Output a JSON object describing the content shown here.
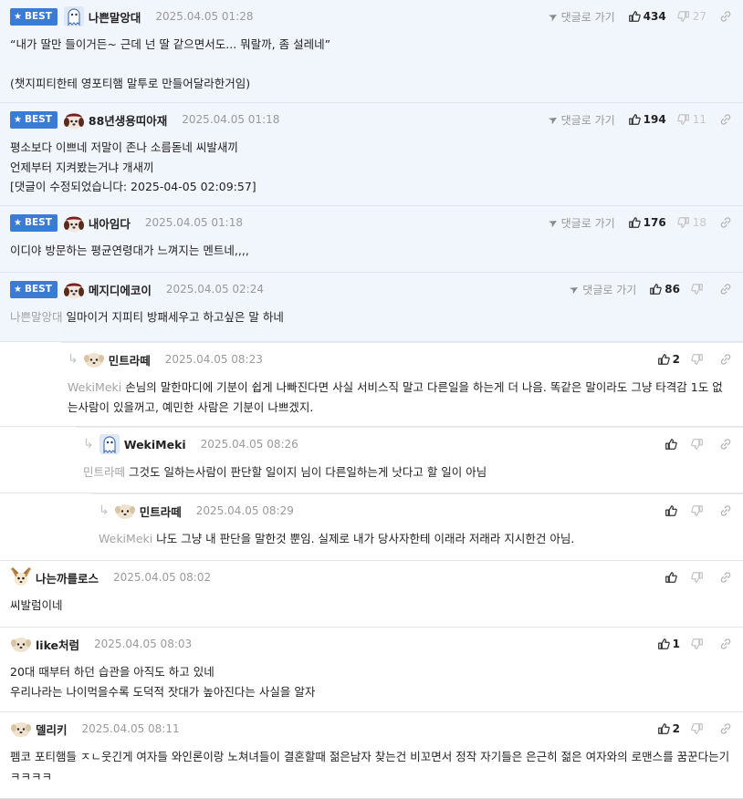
{
  "ui": {
    "best_label": "BEST",
    "goto_label": "댓글로 가기"
  },
  "comments": [
    {
      "best": true,
      "depth": 0,
      "height": 113,
      "avatar": "ghost-avatar",
      "nickname": "나쁜말앙대",
      "date": "2025.04.05 01:28",
      "goto": true,
      "up": "434",
      "down": "27",
      "parent": "",
      "text": "“내가 딸만 들이거든~ 근데 넌 딸 같으면서도... 뭐랄까, 좀 설레네”\n\n(챗지피티한테 영포티햄 말투로 만들어달라한거임)"
    },
    {
      "best": true,
      "depth": 0,
      "height": 113,
      "avatar": "puppy-hat-avatar",
      "nickname": "88년생용띠아재",
      "date": "2025.04.05 01:18",
      "goto": true,
      "up": "194",
      "down": "11",
      "parent": "",
      "text": "평소보다 이쁘네 저말이 존나 소름돋네 씨발새끼\n언제부터 지켜봤는거냐 개새끼\n[댓글이 수정되었습니다: 2025-04-05 02:09:57]"
    },
    {
      "best": true,
      "depth": 0,
      "height": 73,
      "avatar": "puppy-hat-avatar",
      "nickname": "내아임다",
      "date": "2025.04.05 01:18",
      "goto": true,
      "up": "176",
      "down": "18",
      "parent": "",
      "text": "이디야 방문하는 평균연령대가 느껴지는 멘트네,,,,"
    },
    {
      "best": true,
      "depth": 0,
      "height": 76,
      "avatar": "puppy-hat-avatar",
      "nickname": "메지디에코이",
      "date": "2025.04.05 02:24",
      "goto": true,
      "up": "86",
      "down": "",
      "parent": "나쁜말앙대",
      "text": "일마이거 지피티 방패세우고 하고싶은 말 하네"
    },
    {
      "best": false,
      "depth": 1,
      "height": 93,
      "avatar": "round-puppy-avatar",
      "nickname": "민트라떼",
      "date": "2025.04.05 08:23",
      "goto": false,
      "up": "2",
      "down": "",
      "parent": "WekiMeki",
      "text": "손님의 말한마디에 기분이 쉽게 나빠진다면 사실 서비스직 말고 다른일을 하는게 더 나음. 똑같은 말이라도 그냥 타격감 1도 없는사람이 있을꺼고, 예민한 사람은 기분이 나쁘겠지."
    },
    {
      "best": false,
      "depth": 2,
      "height": 73,
      "avatar": "ghost-avatar",
      "nickname": "WekiMeki",
      "date": "2025.04.05 08:26",
      "goto": false,
      "up": "",
      "down": "",
      "parent": "민트라떼",
      "text": "그것도 일하는사람이 판단할 일이지 님이 다른일하는게 낫다고 할 일이 아님"
    },
    {
      "best": false,
      "depth": 3,
      "height": 74,
      "avatar": "round-puppy-avatar",
      "nickname": "민트라떼",
      "date": "2025.04.05 08:29",
      "goto": false,
      "up": "",
      "down": "",
      "parent": "WekiMeki",
      "text": "나도 그냥 내 판단을 말한것 뿐임. 실제로 내가 당사자한테 이래라 저래라 지시한건 아님."
    },
    {
      "best": false,
      "depth": 0,
      "height": 73,
      "avatar": "chihuahua-avatar",
      "nickname": "나는까를로스",
      "date": "2025.04.05 08:02",
      "goto": false,
      "up": "",
      "down": "",
      "parent": "",
      "text": "씨발럼이네"
    },
    {
      "best": false,
      "depth": 0,
      "height": 93,
      "avatar": "round-puppy-avatar",
      "nickname": "like처럼",
      "date": "2025.04.05 08:03",
      "goto": false,
      "up": "1",
      "down": "",
      "parent": "",
      "text": "20대 때부터 하던 습관을 아직도 하고 있네\n우리나라는 나이먹을수록 도덕적 잣대가 높아진다는 사실을 알자"
    },
    {
      "best": false,
      "depth": 0,
      "height": 95,
      "avatar": "round-puppy-avatar",
      "nickname": "델리키",
      "date": "2025.04.05 08:11",
      "goto": false,
      "up": "2",
      "down": "",
      "parent": "",
      "text": "펨코 포티햄들 ㅈㄴ웃긴게 여자들 와인론이랑 노쳐녀들이 결혼할때 젊은남자 찾는건 비꼬면서 정작 자기들은 은근히 젊은 여자와의 로맨스를 꿈꾼다는기 ㅋㅋㅋㅋ"
    }
  ]
}
